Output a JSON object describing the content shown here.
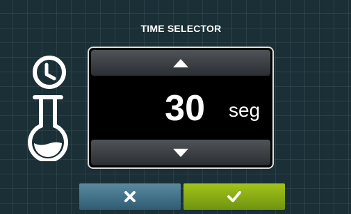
{
  "header": {
    "title": "TIME SELECTOR"
  },
  "icons": {
    "clock": "clock-icon",
    "flask": "flask-icon"
  },
  "selector": {
    "value": "30",
    "unit": "seg",
    "increase_icon": "triangle-up-icon",
    "decrease_icon": "triangle-down-icon"
  },
  "actions": {
    "cancel_icon": "close-icon",
    "confirm_icon": "check-icon"
  },
  "colors": {
    "background": "#1b2f36",
    "cancel": "#3f6f85",
    "confirm": "#8ab51a"
  }
}
